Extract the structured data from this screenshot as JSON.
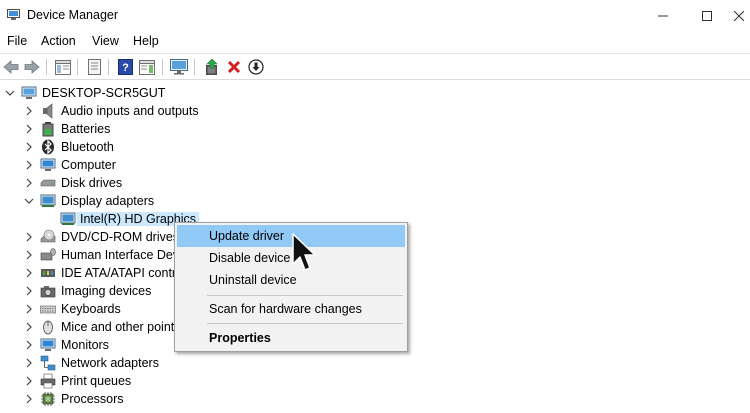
{
  "window": {
    "title": "Device Manager",
    "icons": {
      "app": "device-manager-icon",
      "minimize": "minimize-icon",
      "maximize": "maximize-icon",
      "close": "close-icon"
    }
  },
  "menubar": {
    "items": [
      "File",
      "Action",
      "View",
      "Help"
    ]
  },
  "toolbar": {
    "buttons": [
      "back-icon",
      "forward-icon",
      "console-tree-icon",
      "properties-sheet-icon",
      "help-icon",
      "action-pane-icon",
      "monitor-scan-icon",
      "update-driver-icon",
      "uninstall-icon",
      "download-icon"
    ]
  },
  "tree": {
    "root": "DESKTOP-SCR5GUT",
    "items": [
      {
        "label": "Audio inputs and outputs",
        "icon": "speaker-icon"
      },
      {
        "label": "Batteries",
        "icon": "battery-icon"
      },
      {
        "label": "Bluetooth",
        "icon": "bluetooth-icon"
      },
      {
        "label": "Computer",
        "icon": "computer-icon"
      },
      {
        "label": "Disk drives",
        "icon": "disk-drive-icon"
      },
      {
        "label": "Display adapters",
        "icon": "display-adapter-icon",
        "expanded": true
      },
      {
        "label": "Intel(R) HD Graphics",
        "icon": "display-adapter-icon",
        "selected": true
      },
      {
        "label": "DVD/CD-ROM drives",
        "icon": "dvd-icon"
      },
      {
        "label": "Human Interface Dev",
        "icon": "hid-icon"
      },
      {
        "label": "IDE ATA/ATAPI contro",
        "icon": "ide-icon"
      },
      {
        "label": "Imaging devices",
        "icon": "camera-icon"
      },
      {
        "label": "Keyboards",
        "icon": "keyboard-icon"
      },
      {
        "label": "Mice and other pointi",
        "icon": "mouse-icon"
      },
      {
        "label": "Monitors",
        "icon": "monitor-icon"
      },
      {
        "label": "Network adapters",
        "icon": "network-icon"
      },
      {
        "label": "Print queues",
        "icon": "printer-icon"
      },
      {
        "label": "Processors",
        "icon": "processor-icon"
      }
    ]
  },
  "context_menu": {
    "items": [
      {
        "label": "Update driver",
        "highlighted": true
      },
      {
        "label": "Disable device"
      },
      {
        "label": "Uninstall device"
      },
      {
        "label": "Scan for hardware changes"
      },
      {
        "label": "Properties",
        "bold": true
      }
    ]
  },
  "colors": {
    "selection": "#cce8ff",
    "menu_highlight": "#91c9f7",
    "menu_background": "#f2f2f2"
  }
}
